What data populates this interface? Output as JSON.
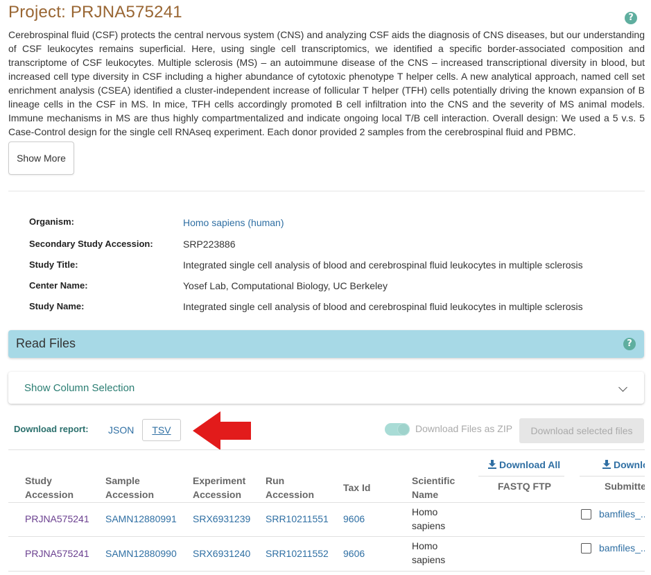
{
  "project": {
    "title": "Project: PRJNA575241",
    "help": "?",
    "description": "Cerebrospinal fluid (CSF) protects the central nervous system (CNS) and analyzing CSF aids the diagnosis of CNS diseases, but our understanding of CSF leukocytes remains superficial. Here, using single cell transcriptomics, we identified a specific border-associated composition and transcriptome of CSF leukocytes. Multiple sclerosis (MS) – an autoimmune disease of the CNS – increased transcriptional diversity in blood, but increased cell type diversity in CSF including a higher abundance of cytotoxic phenotype T helper cells. A new analytical approach, named cell set enrichment analysis (CSEA) identified a cluster-independent increase of follicular T helper (TFH) cells potentially driving the known expansion of B lineage cells in the CSF in MS. In mice, TFH cells accordingly promoted B cell infiltration into the CNS and the severity of MS animal models. Immune mechanisms in MS are thus highly compartmentalized and indicate ongoing local T/B cell interaction. Overall design: We used a 5 v.s. 5 Case-Control design for the single cell RNAseq experiment. Each donor provided 2 samples from the cerebrospinal fluid and PBMC.",
    "show_more": "Show More"
  },
  "meta": {
    "organism_label": "Organism:",
    "organism_value": "Homo sapiens (human)",
    "secondary_label": "Secondary Study Accession:",
    "secondary_value": "SRP223886",
    "study_title_label": "Study Title:",
    "study_title_value": "Integrated single cell analysis of blood and cerebrospinal fluid leukocytes in multiple sclerosis",
    "center_label": "Center Name:",
    "center_value": "Yosef Lab, Computational Biology, UC Berkeley",
    "study_name_label": "Study Name:",
    "study_name_value": "Integrated single cell analysis of blood and cerebrospinal fluid leukocytes in multiple sclerosis"
  },
  "read_files": {
    "title": "Read Files",
    "help": "?",
    "column_selection": "Show Column Selection",
    "download_report_label": "Download report:",
    "json": "JSON",
    "tsv": "TSV",
    "zip_toggle_label": "Download Files as ZIP",
    "download_selected": "Download selected files"
  },
  "table": {
    "headers": {
      "study_1": "Study",
      "study_2": "Accession",
      "sample_1": "Sample",
      "sample_2": "Accession",
      "experiment_1": "Experiment",
      "experiment_2": "Accession",
      "run_1": "Run",
      "run_2": "Accession",
      "tax": "Tax Id",
      "sci_1": "Scientific",
      "sci_2": "Name",
      "download_all_1": "Download All",
      "fastq_ftp": "FASTQ FTP",
      "download_all_2": "Downlo",
      "submitted": "Submitte"
    },
    "rows": [
      {
        "study": "PRJNA575241",
        "sample": "SAMN12880991",
        "experiment": "SRX6931239",
        "run": "SRR10211551",
        "tax": "9606",
        "sci_1": "Homo",
        "sci_2": "sapiens",
        "submitted": "bamfiles_..."
      },
      {
        "study": "PRJNA575241",
        "sample": "SAMN12880990",
        "experiment": "SRX6931240",
        "run": "SRR10211552",
        "tax": "9606",
        "sci_1": "Homo",
        "sci_2": "sapiens",
        "submitted": "bamfiles_..."
      }
    ]
  },
  "colors": {
    "title": "#996633",
    "link": "#2f6fa3",
    "visited_link": "#6a3f8f",
    "read_files_bar": "#a7d9e6",
    "teal": "#2a7d72",
    "arrow": "#e21b1b"
  }
}
